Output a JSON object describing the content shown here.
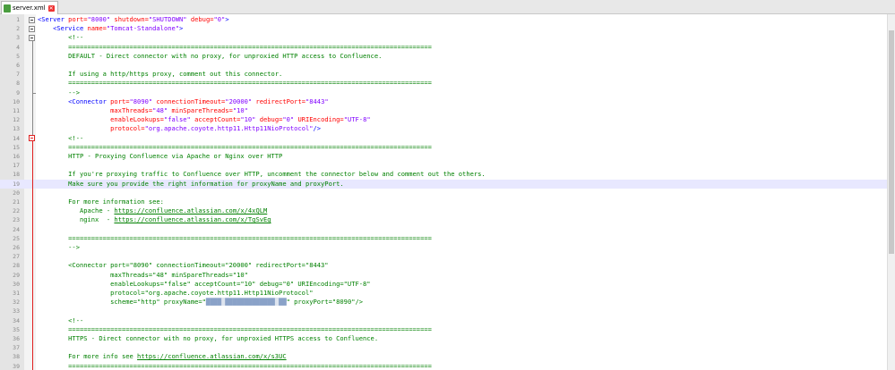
{
  "tab": {
    "filename": "server.xml",
    "close_icon": "close-icon"
  },
  "lines": [
    {
      "n": "1",
      "segs": [
        [
          "tg",
          "<Server "
        ],
        [
          "at",
          "port="
        ],
        [
          "vl",
          "\"8000\""
        ],
        [
          "at",
          " shutdown="
        ],
        [
          "vl",
          "\"SHUTDOWN\""
        ],
        [
          "at",
          " debug="
        ],
        [
          "vl",
          "\"0\""
        ],
        [
          "tg",
          ">"
        ]
      ]
    },
    {
      "n": "2",
      "segs": [
        [
          "tg",
          "    <Service "
        ],
        [
          "at",
          "name="
        ],
        [
          "vl",
          "\"Tomcat-Standalone\""
        ],
        [
          "tg",
          ">"
        ]
      ]
    },
    {
      "n": "3",
      "segs": [
        [
          "cm",
          "        <!--"
        ]
      ]
    },
    {
      "n": "4",
      "segs": [
        [
          "cm",
          "        ==============================================================================================="
        ]
      ]
    },
    {
      "n": "5",
      "segs": [
        [
          "cm",
          "        DEFAULT - Direct connector with no proxy, for unproxied HTTP access to Confluence."
        ]
      ]
    },
    {
      "n": "6",
      "segs": [
        [
          "cm",
          ""
        ]
      ]
    },
    {
      "n": "7",
      "segs": [
        [
          "cm",
          "        If using a http/https proxy, comment out this connector."
        ]
      ]
    },
    {
      "n": "8",
      "segs": [
        [
          "cm",
          "        ==============================================================================================="
        ]
      ]
    },
    {
      "n": "9",
      "segs": [
        [
          "cm",
          "        -->"
        ]
      ]
    },
    {
      "n": "10",
      "segs": [
        [
          "tg",
          "        <Connector "
        ],
        [
          "at",
          "port="
        ],
        [
          "vl",
          "\"8090\""
        ],
        [
          "at",
          " connectionTimeout="
        ],
        [
          "vl",
          "\"20000\""
        ],
        [
          "at",
          " redirectPort="
        ],
        [
          "vl",
          "\"8443\""
        ]
      ]
    },
    {
      "n": "11",
      "segs": [
        [
          "at",
          "                   maxThreads="
        ],
        [
          "vl",
          "\"48\""
        ],
        [
          "at",
          " minSpareThreads="
        ],
        [
          "vl",
          "\"10\""
        ]
      ]
    },
    {
      "n": "12",
      "segs": [
        [
          "at",
          "                   enableLookups="
        ],
        [
          "vl",
          "\"false\""
        ],
        [
          "at",
          " acceptCount="
        ],
        [
          "vl",
          "\"10\""
        ],
        [
          "at",
          " debug="
        ],
        [
          "vl",
          "\"0\""
        ],
        [
          "at",
          " URIEncoding="
        ],
        [
          "vl",
          "\"UTF-8\""
        ]
      ]
    },
    {
      "n": "13",
      "segs": [
        [
          "at",
          "                   protocol="
        ],
        [
          "vl",
          "\"org.apache.coyote.http11.Http11NioProtocol\""
        ],
        [
          "tg",
          "/>"
        ]
      ]
    },
    {
      "n": "14",
      "segs": [
        [
          "cm",
          "        <!--"
        ]
      ]
    },
    {
      "n": "15",
      "segs": [
        [
          "cm",
          "        ==============================================================================================="
        ]
      ]
    },
    {
      "n": "16",
      "segs": [
        [
          "cm",
          "        HTTP - Proxying Confluence via Apache or Nginx over HTTP"
        ]
      ]
    },
    {
      "n": "17",
      "segs": [
        [
          "cm",
          ""
        ]
      ]
    },
    {
      "n": "18",
      "segs": [
        [
          "cm",
          "        If you're proxying traffic to Confluence over HTTP, uncomment the connector below and comment out the others."
        ]
      ]
    },
    {
      "n": "19",
      "segs": [
        [
          "cm",
          "        Make sure you provide the right information for proxyName and proxyPort."
        ]
      ],
      "hl": true
    },
    {
      "n": "20",
      "segs": [
        [
          "cm",
          ""
        ]
      ]
    },
    {
      "n": "21",
      "segs": [
        [
          "cm",
          "        For more information see:"
        ]
      ]
    },
    {
      "n": "22",
      "segs": [
        [
          "cm",
          "           Apache - "
        ],
        [
          "lk",
          "https://confluence.atlassian.com/x/4xQLM"
        ]
      ]
    },
    {
      "n": "23",
      "segs": [
        [
          "cm",
          "           nginx  - "
        ],
        [
          "lk",
          "https://confluence.atlassian.com/x/TgSvEg"
        ]
      ]
    },
    {
      "n": "24",
      "segs": [
        [
          "cm",
          ""
        ]
      ]
    },
    {
      "n": "25",
      "segs": [
        [
          "cm",
          "        ==============================================================================================="
        ]
      ]
    },
    {
      "n": "26",
      "segs": [
        [
          "cm",
          "        -->"
        ]
      ]
    },
    {
      "n": "27",
      "segs": [
        [
          "cm",
          ""
        ]
      ]
    },
    {
      "n": "28",
      "segs": [
        [
          "cm",
          "        <Connector port=\"8090\" connectionTimeout=\"20000\" redirectPort=\"8443\""
        ]
      ]
    },
    {
      "n": "29",
      "segs": [
        [
          "cm",
          "                   maxThreads=\"48\" minSpareThreads=\"10\""
        ]
      ]
    },
    {
      "n": "30",
      "segs": [
        [
          "cm",
          "                   enableLookups=\"false\" acceptCount=\"10\" debug=\"0\" URIEncoding=\"UTF-8\""
        ]
      ]
    },
    {
      "n": "31",
      "segs": [
        [
          "cm",
          "                   protocol=\"org.apache.coyote.http11.Http11NioProtocol\""
        ]
      ]
    },
    {
      "n": "32",
      "segs": [
        [
          "cm",
          "                   scheme=\"http\" proxyName=\""
        ],
        [
          "blur",
          "████ █████████████ ██"
        ],
        [
          "cm",
          "\" proxyPort=\"8090\"/>"
        ]
      ]
    },
    {
      "n": "33",
      "segs": [
        [
          "cm",
          ""
        ]
      ]
    },
    {
      "n": "34",
      "segs": [
        [
          "cm",
          "        <!--"
        ]
      ]
    },
    {
      "n": "35",
      "segs": [
        [
          "cm",
          "        ==============================================================================================="
        ]
      ]
    },
    {
      "n": "36",
      "segs": [
        [
          "cm",
          "        HTTPS - Direct connector with no proxy, for unproxied HTTPS access to Confluence."
        ]
      ]
    },
    {
      "n": "37",
      "segs": [
        [
          "cm",
          ""
        ]
      ]
    },
    {
      "n": "38",
      "segs": [
        [
          "cm",
          "        For more info see "
        ],
        [
          "lk",
          "https://confluence.atlassian.com/x/s3UC"
        ]
      ]
    },
    {
      "n": "39",
      "segs": [
        [
          "cm",
          "        ==============================================================================================="
        ]
      ]
    }
  ]
}
